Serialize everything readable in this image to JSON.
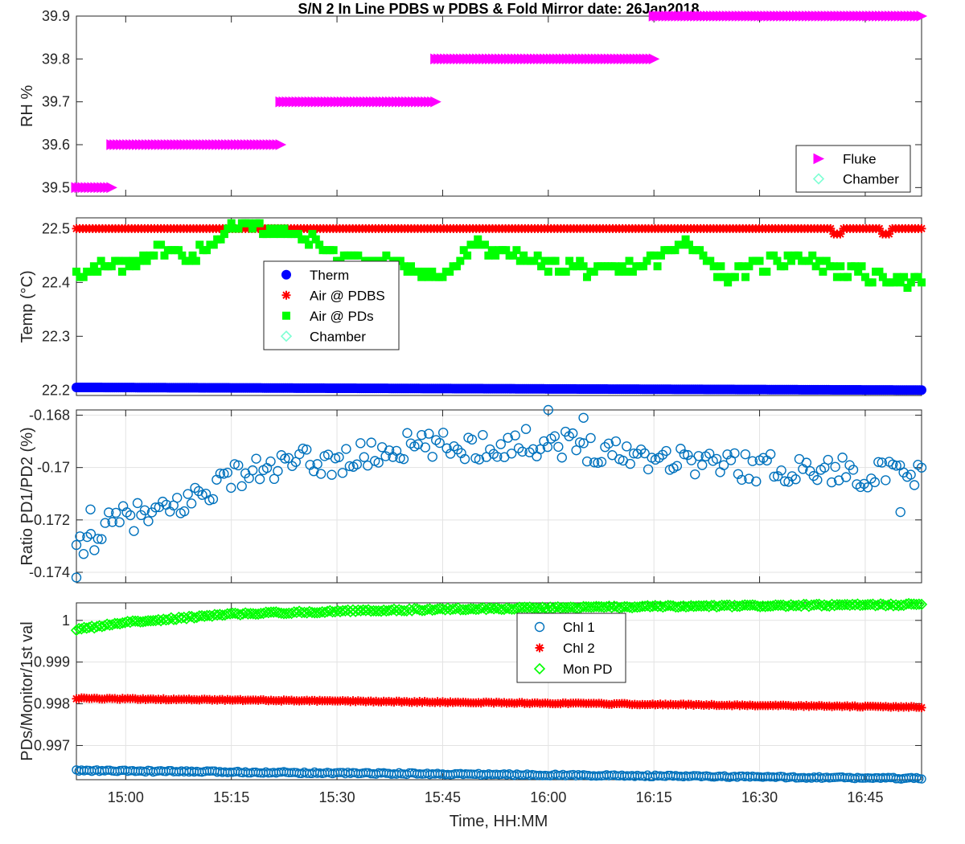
{
  "figure": {
    "title": "S/N 2 In Line PDBS w PDBS & Fold Mirror date: 26Jan2018",
    "xlabel": "Time, HH:MM",
    "x_ticks": [
      "15:00",
      "15:15",
      "15:30",
      "15:45",
      "16:00",
      "16:15",
      "16:30",
      "16:45"
    ]
  },
  "chart_data": [
    {
      "type": "scatter",
      "ylabel": "RH %",
      "xlim": [
        "14:53",
        "16:53"
      ],
      "ylim": [
        39.48,
        39.9
      ],
      "y_ticks": [
        "39.5",
        "39.6",
        "39.7",
        "39.8",
        "39.9"
      ],
      "grid": false,
      "legend_position": "bottom-right",
      "legend": [
        {
          "name": "Fluke",
          "marker": "triangle-right",
          "color": "#ff00ff"
        },
        {
          "name": "Chamber",
          "marker": "diamond-open",
          "color": "#7fffd4"
        }
      ],
      "series": [
        {
          "name": "Fluke",
          "segments": [
            {
              "x_start": "14:53",
              "x_end": "14:58",
              "y": 39.5
            },
            {
              "x_start": "14:58",
              "x_end": "15:22",
              "y": 39.6
            },
            {
              "x_start": "15:22",
              "x_end": "15:44",
              "y": 39.7
            },
            {
              "x_start": "15:44",
              "x_end": "16:15",
              "y": 39.8
            },
            {
              "x_start": "16:15",
              "x_end": "16:53",
              "y": 39.9
            }
          ]
        },
        {
          "name": "Chamber",
          "values": []
        }
      ]
    },
    {
      "type": "scatter",
      "ylabel": "Temp (°C)",
      "xlim": [
        "14:53",
        "16:53"
      ],
      "ylim": [
        22.19,
        22.52
      ],
      "y_ticks": [
        "22.2",
        "22.3",
        "22.4",
        "22.5"
      ],
      "grid": false,
      "legend_position": "center-left",
      "legend": [
        {
          "name": "Therm",
          "marker": "circle-filled",
          "color": "#0000ff"
        },
        {
          "name": "Air @ PDBS",
          "marker": "asterisk",
          "color": "#ff0000"
        },
        {
          "name": "Air @ PDs",
          "marker": "square-filled",
          "color": "#00ff00"
        },
        {
          "name": "Chamber",
          "marker": "diamond-open",
          "color": "#7fffd4"
        }
      ],
      "series": [
        {
          "name": "Therm",
          "start": 22.205,
          "end": 22.2
        },
        {
          "name": "Air @ PDBS",
          "base": 22.5,
          "dips": [
            {
              "x": "16:41",
              "y": 22.49
            },
            {
              "x": "16:48",
              "y": 22.49
            }
          ]
        },
        {
          "name": "Air @ PDs",
          "key_points": [
            {
              "x": "14:53",
              "y": 22.42
            },
            {
              "x": "15:00",
              "y": 22.43
            },
            {
              "x": "15:05",
              "y": 22.46
            },
            {
              "x": "15:10",
              "y": 22.45
            },
            {
              "x": "15:15",
              "y": 22.5
            },
            {
              "x": "15:18",
              "y": 22.51
            },
            {
              "x": "15:22",
              "y": 22.49
            },
            {
              "x": "15:26",
              "y": 22.48
            },
            {
              "x": "15:30",
              "y": 22.45
            },
            {
              "x": "15:40",
              "y": 22.43
            },
            {
              "x": "15:45",
              "y": 22.41
            },
            {
              "x": "15:50",
              "y": 22.47
            },
            {
              "x": "16:00",
              "y": 22.43
            },
            {
              "x": "16:10",
              "y": 22.42
            },
            {
              "x": "16:15",
              "y": 22.44
            },
            {
              "x": "16:20",
              "y": 22.48
            },
            {
              "x": "16:25",
              "y": 22.41
            },
            {
              "x": "16:35",
              "y": 22.45
            },
            {
              "x": "16:42",
              "y": 22.42
            },
            {
              "x": "16:53",
              "y": 22.4
            }
          ]
        },
        {
          "name": "Chamber",
          "values": []
        }
      ]
    },
    {
      "type": "scatter",
      "ylabel": "Ratio PD1/PD2 (%)",
      "xlim": [
        "14:53",
        "16:53"
      ],
      "ylim": [
        -0.1744,
        -0.1678
      ],
      "y_ticks": [
        "-0.168",
        "-0.17",
        "-0.172",
        "-0.174"
      ],
      "grid": true,
      "series": [
        {
          "name": "Ratio",
          "marker": "circle-open",
          "color": "#0072bd",
          "key_points": [
            {
              "x": "14:53",
              "y": -0.1733
            },
            {
              "x": "14:56",
              "y": -0.1725
            },
            {
              "x": "15:00",
              "y": -0.1719
            },
            {
              "x": "15:05",
              "y": -0.1718
            },
            {
              "x": "15:10",
              "y": -0.1711
            },
            {
              "x": "15:15",
              "y": -0.1703
            },
            {
              "x": "15:20",
              "y": -0.1701
            },
            {
              "x": "15:25",
              "y": -0.1698
            },
            {
              "x": "15:30",
              "y": -0.1698
            },
            {
              "x": "15:40",
              "y": -0.1692
            },
            {
              "x": "15:50",
              "y": -0.1692
            },
            {
              "x": "16:00",
              "y": -0.169
            },
            {
              "x": "16:10",
              "y": -0.1694
            },
            {
              "x": "16:20",
              "y": -0.1697
            },
            {
              "x": "16:30",
              "y": -0.17
            },
            {
              "x": "16:40",
              "y": -0.1701
            },
            {
              "x": "16:53",
              "y": -0.1704
            }
          ],
          "outliers": [
            {
              "x": "14:53",
              "y": -0.1742
            },
            {
              "x": "16:00",
              "y": -0.1678
            },
            {
              "x": "16:05",
              "y": -0.1681
            },
            {
              "x": "16:50",
              "y": -0.1717
            },
            {
              "x": "14:55",
              "y": -0.1716
            }
          ]
        }
      ]
    },
    {
      "type": "scatter",
      "ylabel": "PDs/Monitor/1st val",
      "xlim": [
        "14:53",
        "16:53"
      ],
      "ylim": [
        0.99618,
        1.00042
      ],
      "y_ticks": [
        "1",
        "0.999",
        "0.998",
        "0.997"
      ],
      "grid": true,
      "legend_position": "top-center",
      "legend": [
        {
          "name": "Chl 1",
          "marker": "circle-open",
          "color": "#0072bd"
        },
        {
          "name": "Chl 2",
          "marker": "asterisk",
          "color": "#ff0000"
        },
        {
          "name": "Mon PD",
          "marker": "diamond-open",
          "color": "#00ff00"
        }
      ],
      "series": [
        {
          "name": "Chl 1",
          "start": 0.9964,
          "end": 0.99621
        },
        {
          "name": "Chl 2",
          "start": 0.99813,
          "end": 0.99792
        },
        {
          "name": "Mon PD",
          "key_points": [
            {
              "x": "14:53",
              "y": 0.99978
            },
            {
              "x": "15:00",
              "y": 0.99995
            },
            {
              "x": "15:15",
              "y": 1.00015
            },
            {
              "x": "15:30",
              "y": 1.00022
            },
            {
              "x": "15:45",
              "y": 1.00027
            },
            {
              "x": "16:00",
              "y": 1.0003
            },
            {
              "x": "16:15",
              "y": 1.00033
            },
            {
              "x": "16:30",
              "y": 1.00035
            },
            {
              "x": "16:53",
              "y": 1.00038
            }
          ]
        }
      ]
    }
  ]
}
